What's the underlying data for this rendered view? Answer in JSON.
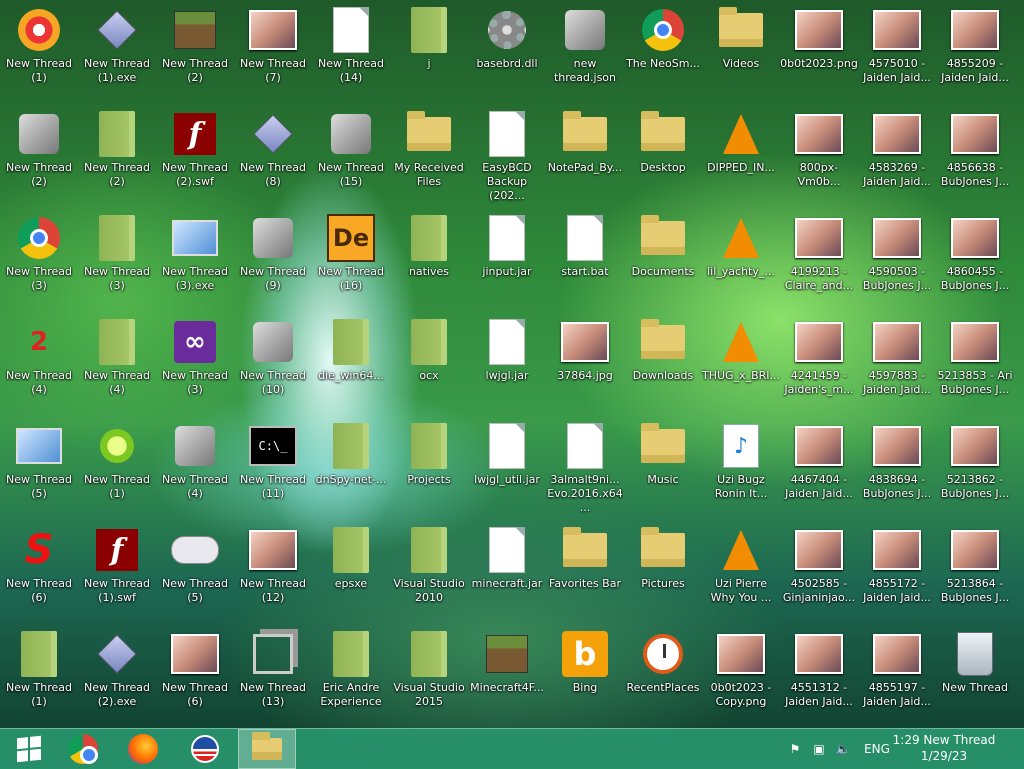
{
  "desktop_icons": [
    {
      "label": "New Thread (1)",
      "icon": "paint-app-icon"
    },
    {
      "label": "New Thread (1).exe",
      "icon": "diamond-exe-icon"
    },
    {
      "label": "New Thread (2)",
      "icon": "minecraft-block-icon"
    },
    {
      "label": "New Thread (7)",
      "icon": "bunny-image-icon"
    },
    {
      "label": "New Thread (14)",
      "icon": "file-icon"
    },
    {
      "label": "j",
      "icon": "green-folder-icon"
    },
    {
      "label": "basebrd.dll",
      "icon": "gear-icon"
    },
    {
      "label": "new thread.json",
      "icon": "music-app-icon"
    },
    {
      "label": "The NeoSm...",
      "icon": "chrome-icon"
    },
    {
      "label": "Videos",
      "icon": "videos-folder-icon"
    },
    {
      "label": "0b0t2023.png",
      "icon": "image-icon"
    },
    {
      "label": "4575010 - Jaiden Jaid...",
      "icon": "image-icon"
    },
    {
      "label": "4855209 - Jaiden Jaid...",
      "icon": "image-icon"
    },
    {
      "label": "New Thread (2)",
      "icon": "red-emblem-icon"
    },
    {
      "label": "New Thread (2)",
      "icon": "green-folder-icon"
    },
    {
      "label": "New Thread (2).swf",
      "icon": "flash-icon"
    },
    {
      "label": "New Thread (8)",
      "icon": "diamond-exe-icon"
    },
    {
      "label": "New Thread (15)",
      "icon": "troll-face-icon"
    },
    {
      "label": "My Received Files",
      "icon": "folder-icon"
    },
    {
      "label": "EasyBCD Backup (202...",
      "icon": "file-icon"
    },
    {
      "label": "NotePad_By...",
      "icon": "notepad-folder-icon"
    },
    {
      "label": "Desktop",
      "icon": "desktop-folder-icon"
    },
    {
      "label": "DIPPED_IN...",
      "icon": "vlc-icon"
    },
    {
      "label": "800px-Vm0b...",
      "icon": "image-icon"
    },
    {
      "label": "4583269 - Jaiden Jaid...",
      "icon": "image-icon"
    },
    {
      "label": "4856638 - BubJones J...",
      "icon": "image-icon"
    },
    {
      "label": "New Thread (3)",
      "icon": "chrome-icon"
    },
    {
      "label": "New Thread (3)",
      "icon": "green-folder-icon"
    },
    {
      "label": "New Thread (3).exe",
      "icon": "monitor-app-icon"
    },
    {
      "label": "New Thread (9)",
      "icon": "skull-icon"
    },
    {
      "label": "New Thread (16)",
      "icon": "de-app-icon"
    },
    {
      "label": "natives",
      "icon": "green-folder-icon"
    },
    {
      "label": "jinput.jar",
      "icon": "file-icon"
    },
    {
      "label": "start.bat",
      "icon": "batch-file-icon"
    },
    {
      "label": "Documents",
      "icon": "documents-folder-icon"
    },
    {
      "label": "lil_yachty_...",
      "icon": "vlc-icon"
    },
    {
      "label": "4199213 - Claire_and...",
      "icon": "image-icon"
    },
    {
      "label": "4590503 - BubJones J...",
      "icon": "image-icon"
    },
    {
      "label": "4860455 - BubJones J...",
      "icon": "image-icon"
    },
    {
      "label": "New Thread (4)",
      "icon": "red-two-icon"
    },
    {
      "label": "New Thread (4)",
      "icon": "green-folder-icon"
    },
    {
      "label": "New Thread (3)",
      "icon": "visual-studio-icon"
    },
    {
      "label": "New Thread (10)",
      "icon": "doctor-icon"
    },
    {
      "label": "die_win64...",
      "icon": "green-folder-icon"
    },
    {
      "label": "ocx",
      "icon": "green-folder-icon"
    },
    {
      "label": "lwjgl.jar",
      "icon": "file-icon"
    },
    {
      "label": "37864.jpg",
      "icon": "image-icon"
    },
    {
      "label": "Downloads",
      "icon": "downloads-folder-icon"
    },
    {
      "label": "THUG_x_BRI...",
      "icon": "vlc-icon"
    },
    {
      "label": "4241459 - Jaiden's_m...",
      "icon": "image-icon"
    },
    {
      "label": "4597883 - Jaiden Jaid...",
      "icon": "image-icon"
    },
    {
      "label": "5213853 - Ari BubJones J...",
      "icon": "image-icon"
    },
    {
      "label": "New Thread (5)",
      "icon": "computer-icon"
    },
    {
      "label": "New Thread (1)",
      "icon": "lime-icon"
    },
    {
      "label": "New Thread (4)",
      "icon": "app-box-icon"
    },
    {
      "label": "New Thread (11)",
      "icon": "command-prompt-icon"
    },
    {
      "label": "dnSpy-net-...",
      "icon": "green-folder-icon"
    },
    {
      "label": "Projects",
      "icon": "green-folder-icon"
    },
    {
      "label": "lwjgl_util.jar",
      "icon": "file-icon"
    },
    {
      "label": "3almalt9ni... Evo.2016.x64...",
      "icon": "file-icon"
    },
    {
      "label": "Music",
      "icon": "music-folder-icon"
    },
    {
      "label": "Uzi Bugz Ronin It...",
      "icon": "m4a-icon"
    },
    {
      "label": "4467404 - Jaiden Jaid...",
      "icon": "image-icon"
    },
    {
      "label": "4838694 - BubJones J...",
      "icon": "image-icon"
    },
    {
      "label": "5213862 - BubJones J...",
      "icon": "image-icon"
    },
    {
      "label": "New Thread (6)",
      "icon": "red-s-icon"
    },
    {
      "label": "New Thread (1).swf",
      "icon": "flash-icon"
    },
    {
      "label": "New Thread (5)",
      "icon": "gamepad-icon"
    },
    {
      "label": "New Thread (12)",
      "icon": "portrait-icon"
    },
    {
      "label": "epsxe",
      "icon": "green-folder-icon"
    },
    {
      "label": "Visual Studio 2010",
      "icon": "green-folder-icon"
    },
    {
      "label": "minecraft.jar",
      "icon": "file-icon"
    },
    {
      "label": "Favorites Bar",
      "icon": "folder-icon"
    },
    {
      "label": "Pictures",
      "icon": "pictures-folder-icon"
    },
    {
      "label": "Uzi Pierre Why You ...",
      "icon": "vlc-icon"
    },
    {
      "label": "4502585 - Ginjaninjao...",
      "icon": "image-icon"
    },
    {
      "label": "4855172 - Jaiden Jaid...",
      "icon": "image-icon"
    },
    {
      "label": "5213864 - BubJones J...",
      "icon": "image-icon"
    },
    {
      "label": "New Thread (1)",
      "icon": "green-folder-icon"
    },
    {
      "label": "New Thread (2).exe",
      "icon": "diamond-exe-icon"
    },
    {
      "label": "New Thread (6)",
      "icon": "portrait-icon"
    },
    {
      "label": "New Thread (13)",
      "icon": "stack-windows-icon"
    },
    {
      "label": "Eric Andre Experience",
      "icon": "green-folder-icon"
    },
    {
      "label": "Visual Studio 2015",
      "icon": "green-folder-icon"
    },
    {
      "label": "Minecraft4F...",
      "icon": "minecraft-block-icon"
    },
    {
      "label": "Bing",
      "icon": "bing-icon"
    },
    {
      "label": "RecentPlaces",
      "icon": "clock-icon"
    },
    {
      "label": "0b0t2023 - Copy.png",
      "icon": "image-icon"
    },
    {
      "label": "4551312 - Jaiden Jaid...",
      "icon": "image-icon"
    },
    {
      "label": "4855197 - Jaiden Jaid...",
      "icon": "image-icon"
    },
    {
      "label": "New Thread",
      "icon": "recycle-bin-icon"
    }
  ],
  "taskbar": {
    "pinned": [
      {
        "name": "start-button",
        "icon": "windows-logo-icon"
      },
      {
        "name": "taskbar-chrome",
        "icon": "chrome-icon"
      },
      {
        "name": "taskbar-firefox",
        "icon": "firefox-icon"
      },
      {
        "name": "taskbar-app",
        "icon": "obama-logo-icon"
      },
      {
        "name": "taskbar-file-explorer",
        "icon": "file-explorer-icon"
      }
    ],
    "tray": {
      "language": "ENG",
      "time": "1:29 New Thread",
      "date": "1/29/23"
    },
    "colors": {
      "taskbar": "#2aa06e",
      "accent": "#ffffff"
    }
  }
}
